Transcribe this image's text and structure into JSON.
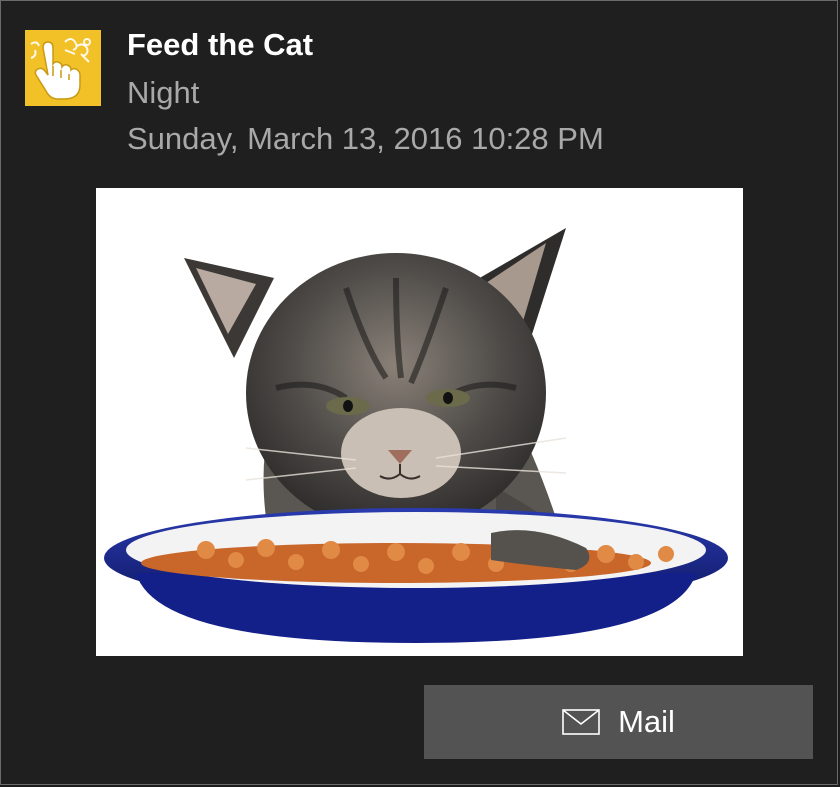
{
  "notification": {
    "app_icon": "feed-the-cat-app-icon",
    "title": "Feed the Cat",
    "subtitle": "Night",
    "timestamp": "Sunday, March 13, 2016 10:28 PM",
    "hero_image": "kitten-eating-from-bowl"
  },
  "actions": [
    {
      "label": "Mail",
      "icon": "mail-icon"
    }
  ],
  "colors": {
    "background": "#1f1f1f",
    "icon_bg": "#f2c027",
    "button_bg": "#535353",
    "secondary_text": "#a9a9a9",
    "bowl": "#1c2a8a",
    "kibble": "#d9772e"
  }
}
